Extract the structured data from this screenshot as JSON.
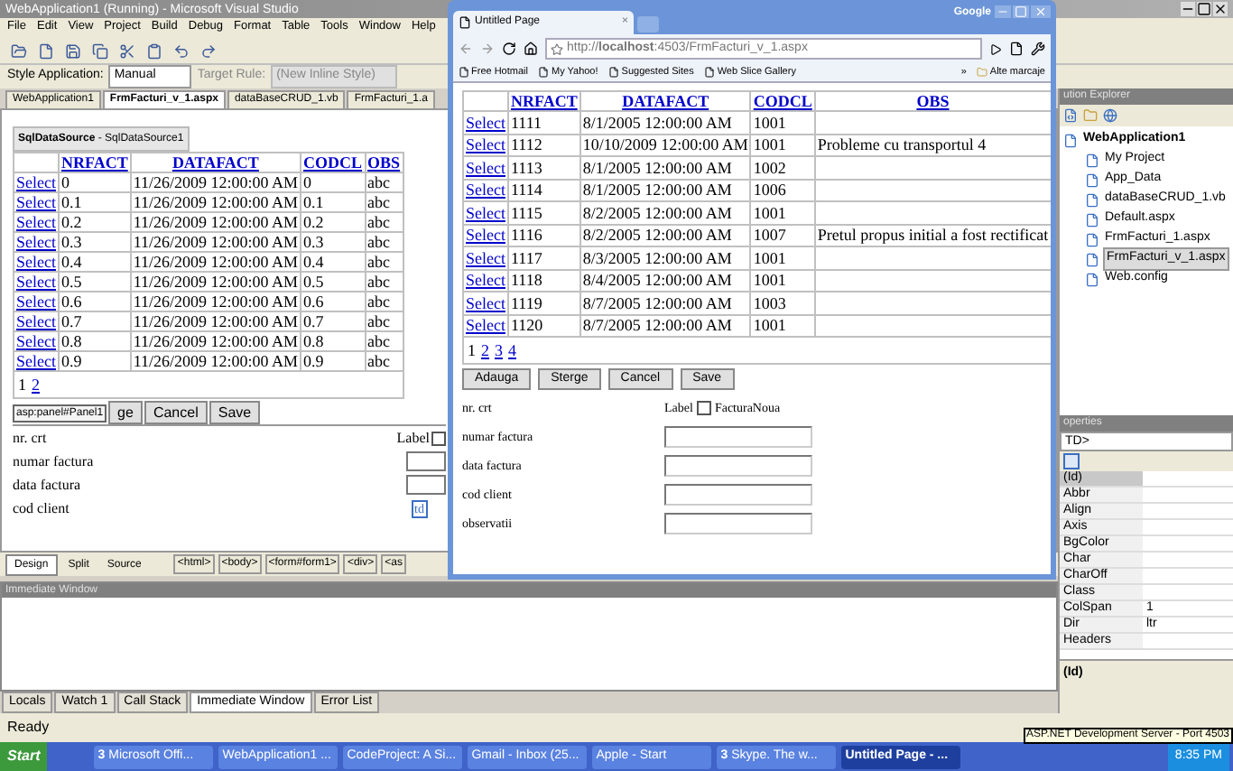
{
  "vs": {
    "title": "WebApplication1 (Running) - Microsoft Visual Studio",
    "menu": [
      "File",
      "Edit",
      "View",
      "Project",
      "Build",
      "Debug",
      "Format",
      "Table",
      "Tools",
      "Window",
      "Help"
    ],
    "style_bar": {
      "style_label": "Style Application:",
      "style_value": "Manual",
      "target_label": "Target Rule:",
      "target_value": "(New Inline Style)"
    },
    "doc_tabs": [
      {
        "label": "WebApplication1",
        "selected": false
      },
      {
        "label": "FrmFacturi_v_1.aspx",
        "selected": true
      },
      {
        "label": "dataBaseCRUD_1.vb",
        "selected": false
      },
      {
        "label": "FrmFacturi_1.a",
        "selected": false
      }
    ],
    "designer": {
      "datasource": "**SqlDataSource** - SqlDataSource1",
      "columns": [
        "NRFACT",
        "DATAFACT",
        "CODCL",
        "OBS"
      ],
      "rows": [
        {
          "link": "Select",
          "cells": [
            "0",
            "11/26/2009 12:00:00 AM",
            "0",
            "abc"
          ]
        },
        {
          "link": "Select",
          "cells": [
            "0.1",
            "11/26/2009 12:00:00 AM",
            "0.1",
            "abc"
          ]
        },
        {
          "link": "Select",
          "cells": [
            "0.2",
            "11/26/2009 12:00:00 AM",
            "0.2",
            "abc"
          ]
        },
        {
          "link": "Select",
          "cells": [
            "0.3",
            "11/26/2009 12:00:00 AM",
            "0.3",
            "abc"
          ]
        },
        {
          "link": "Select",
          "cells": [
            "0.4",
            "11/26/2009 12:00:00 AM",
            "0.4",
            "abc"
          ]
        },
        {
          "link": "Select",
          "cells": [
            "0.5",
            "11/26/2009 12:00:00 AM",
            "0.5",
            "abc"
          ]
        },
        {
          "link": "Select",
          "cells": [
            "0.6",
            "11/26/2009 12:00:00 AM",
            "0.6",
            "abc"
          ]
        },
        {
          "link": "Select",
          "cells": [
            "0.7",
            "11/26/2009 12:00:00 AM",
            "0.7",
            "abc"
          ]
        },
        {
          "link": "Select",
          "cells": [
            "0.8",
            "11/26/2009 12:00:00 AM",
            "0.8",
            "abc"
          ]
        },
        {
          "link": "Select",
          "cells": [
            "0.9",
            "11/26/2009 12:00:00 AM",
            "0.9",
            "abc"
          ]
        }
      ],
      "pager": [
        {
          "label": "1",
          "selected": true
        },
        {
          "label": "2",
          "selected": false
        }
      ],
      "panel_tag": "asp:panel#Panel1",
      "buttons": [
        "ge",
        "Cancel",
        "Save"
      ],
      "fields": [
        {
          "label": "nr. crt",
          "kind": "checkbox",
          "checkbox_label": "Label",
          "checked": false
        },
        {
          "label": "numar factura",
          "kind": "input"
        },
        {
          "label": "data factura",
          "kind": "input"
        },
        {
          "label": "cod client",
          "kind": "tag",
          "tag": "td"
        }
      ]
    },
    "view_tabs": [
      {
        "label": "Design",
        "selected": true
      },
      {
        "label": "Split",
        "selected": false
      },
      {
        "label": "Source",
        "selected": false
      }
    ],
    "breadcrumbs": [
      "<html>",
      "<body>",
      "<form#form1>",
      "<div>",
      "<as"
    ],
    "solution_explorer": {
      "title": "ution Explorer",
      "root": {
        "label": "WebApplication1",
        "selected": false,
        "children": [
          {
            "label": "My Project",
            "selected": false
          },
          {
            "label": "App_Data",
            "selected": false
          },
          {
            "label": "dataBaseCRUD_1.vb",
            "selected": false
          },
          {
            "label": "Default.aspx",
            "selected": false
          },
          {
            "label": "FrmFacturi_1.aspx",
            "selected": false
          },
          {
            "label": "FrmFacturi_v_1.aspx",
            "selected": true
          },
          {
            "label": "Web.config",
            "selected": false
          }
        ]
      }
    },
    "properties": {
      "title": "operties",
      "selector": "TD>",
      "rows": [
        {
          "name": "(Id)",
          "selected": true
        },
        {
          "name": "Abbr",
          "selected": false
        },
        {
          "name": "Align",
          "selected": false
        },
        {
          "name": "Axis",
          "selected": false
        },
        {
          "name": "BgColor",
          "selected": false
        },
        {
          "name": "Char",
          "selected": false
        },
        {
          "name": "CharOff",
          "selected": false
        },
        {
          "name": "Class",
          "selected": false
        },
        {
          "name": "ColSpan",
          "value": "1",
          "selected": false
        },
        {
          "name": "Dir",
          "value": "ltr",
          "selected": false
        },
        {
          "name": "Headers",
          "selected": false
        }
      ],
      "description": "(Id)"
    },
    "immediate": {
      "title": "Immediate Window"
    },
    "bottom_tabs": [
      {
        "label": "Locals",
        "selected": false
      },
      {
        "label": "Watch 1",
        "selected": false
      },
      {
        "label": "Call Stack",
        "selected": false
      },
      {
        "label": "Immediate Window",
        "selected": true
      },
      {
        "label": "Error List",
        "selected": false
      }
    ],
    "status": "Ready"
  },
  "browser": {
    "brand": "Google",
    "tab": "Untitled Page",
    "tab_close": "×",
    "url": "http://**localhost**:4503/FrmFacturi_v_1.aspx",
    "bookmarks": [
      "Free Hotmail",
      "My Yahoo!",
      "Suggested Sites",
      "Web Slice Gallery"
    ],
    "more": "»",
    "other_bookmarks": "Alte marcaje",
    "columns": [
      "NRFACT",
      "DATAFACT",
      "CODCL",
      "OBS"
    ],
    "rows": [
      {
        "link": "Select",
        "cells": [
          "1111",
          "8/1/2005 12:00:00 AM",
          "1001"
        ]
      },
      {
        "link": "Select",
        "cells": [
          "1112",
          "10/10/2009 12:00:00 AM",
          "1001",
          "Probleme cu transportul 4"
        ]
      },
      {
        "link": "Select",
        "cells": [
          "1113",
          "8/1/2005 12:00:00 AM",
          "1002"
        ]
      },
      {
        "link": "Select",
        "cells": [
          "1114",
          "8/1/2005 12:00:00 AM",
          "1006"
        ]
      },
      {
        "link": "Select",
        "cells": [
          "1115",
          "8/2/2005 12:00:00 AM",
          "1001"
        ]
      },
      {
        "link": "Select",
        "cells": [
          "1116",
          "8/2/2005 12:00:00 AM",
          "1007",
          "Pretul propus initial a fost rectificat"
        ]
      },
      {
        "link": "Select",
        "cells": [
          "1117",
          "8/3/2005 12:00:00 AM",
          "1001"
        ]
      },
      {
        "link": "Select",
        "cells": [
          "1118",
          "8/4/2005 12:00:00 AM",
          "1001"
        ]
      },
      {
        "link": "Select",
        "cells": [
          "1119",
          "8/7/2005 12:00:00 AM",
          "1003"
        ]
      },
      {
        "link": "Select",
        "cells": [
          "1120",
          "8/7/2005 12:00:00 AM",
          "1001"
        ]
      }
    ],
    "pager": [
      {
        "label": "1",
        "selected": true
      },
      {
        "label": "2",
        "selected": false
      },
      {
        "label": "3",
        "selected": false
      },
      {
        "label": "4",
        "selected": false
      }
    ],
    "buttons": [
      "Adauga",
      "Sterge",
      "Cancel",
      "Save"
    ],
    "fields": [
      {
        "label": "nr. crt",
        "kind": "checkbox",
        "checkbox_label": "Label",
        "checked": false,
        "check_text": "FacturaNoua"
      },
      {
        "label": "numar factura",
        "kind": "input"
      },
      {
        "label": "data factura",
        "kind": "input"
      },
      {
        "label": "cod client",
        "kind": "input"
      },
      {
        "label": "observatii",
        "kind": "input"
      }
    ]
  },
  "taskbar": {
    "start": "Start",
    "items": [
      {
        "count": "3",
        "label": "Microsoft Offi...",
        "selected": false
      },
      {
        "label": "WebApplication1 ...",
        "selected": false
      },
      {
        "label": "CodeProject: A Si...",
        "selected": false
      },
      {
        "label": "Gmail - Inbox (25...",
        "selected": false
      },
      {
        "label": "Apple - Start",
        "selected": false
      },
      {
        "count": "3",
        "label": "Skype. The w...",
        "selected": false
      },
      {
        "label": "Untitled Page - ...",
        "selected": true
      }
    ],
    "clock": "8:35 PM",
    "tooltip": "ASP.NET Development Server - Port 4503"
  }
}
